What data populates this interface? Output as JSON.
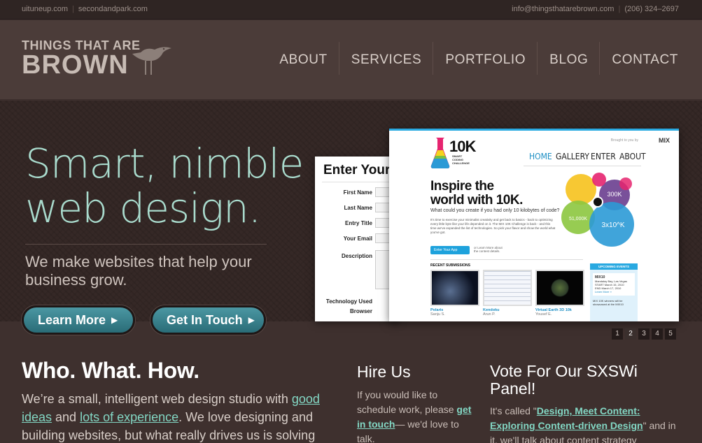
{
  "topbar": {
    "link1": "uituneup.com",
    "link2": "secondandpark.com",
    "email": "info@thingsthatarebrown.com",
    "phone": "(206) 324–2697"
  },
  "logo": {
    "line1": "THINGS THAT ARE",
    "line2": "BROWN"
  },
  "nav": [
    "ABOUT",
    "SERVICES",
    "PORTFOLIO",
    "BLOG",
    "CONTACT"
  ],
  "hero": {
    "title_line1": "Smart, nimble",
    "title_line2": "web design.",
    "subtitle": "We make websites that help your business grow.",
    "btn_learn": "Learn More",
    "btn_touch": "Get In Touch"
  },
  "mock_back": {
    "title": "Enter Your",
    "labels": [
      "First Name",
      "Last Name",
      "Entry Title",
      "Your Email",
      "Description",
      "Technology Used",
      "Browser"
    ]
  },
  "mock_front": {
    "brought_by": "Brought to you by",
    "brand": "MIX",
    "logo": "10K",
    "logo_sub": "SMART CODING CHALLENGE",
    "nav": [
      "HOME",
      "GALLERY",
      "ENTER",
      "ABOUT"
    ],
    "headline1": "Inspire the",
    "headline2": "world with 10K.",
    "question": "What could you create if you had only 10 kilobytes of code?",
    "body": "It's time to exercise your minimalist creativity and get back to basics - back to optimizing every little byte like your life depended on it. The MIX 10K Challenge is back - and this time we've expanded the list of technologies. So pick your flavor and show the world what you've got.",
    "enter_btn": "Enter Your App",
    "learn_more": "or Learn More about the contest details.",
    "recent": "RECENT SUBMISSIONS",
    "subs": [
      {
        "name": "Polaris",
        "author": "Sanju S."
      },
      {
        "name": "Kendoku",
        "author": "Arun P."
      },
      {
        "name": "Virtual Earth 3D 10k",
        "author": "Yousef E."
      }
    ],
    "events_header": "UPCOMING EVENTS",
    "event_name": "MIX10",
    "event_place": "Mandalay Bay, Las Vegas",
    "event_start": "START  March 15, 2010",
    "event_end": "END  March 17, 2010",
    "event_more": "Learn More »",
    "event_note": "MIX 10K winners will be showcased at the MIX10",
    "circle_a": "51,000K",
    "circle_b": "300K",
    "circle_c": "3x10^K"
  },
  "pager": [
    "1",
    "2",
    "3",
    "4",
    "5"
  ],
  "who": {
    "title": "Who. What. How.",
    "t1": "We’re a small, intelligent web design studio with ",
    "l1": "good ideas",
    "t2": " and ",
    "l2": "lots of experience",
    "t3": ". We love designing and building websites, but what really drives us is solving"
  },
  "hire": {
    "title": "Hire Us",
    "t1": "If you would like to schedule work, please ",
    "l1": "get in touch",
    "t2": "— we'd love to talk."
  },
  "vote": {
    "title": "Vote For Our SXSWi Panel!",
    "t1": "It's called \"",
    "l1": "Design, Meet Content: Exploring Content-driven Design",
    "t2": "\" and in it, we'll talk about content strategy"
  },
  "colors": {
    "accent": "#83d7c4",
    "hero_title": "#a9dbcd",
    "button": "#2f7f8b",
    "bg": "#3e302e"
  }
}
